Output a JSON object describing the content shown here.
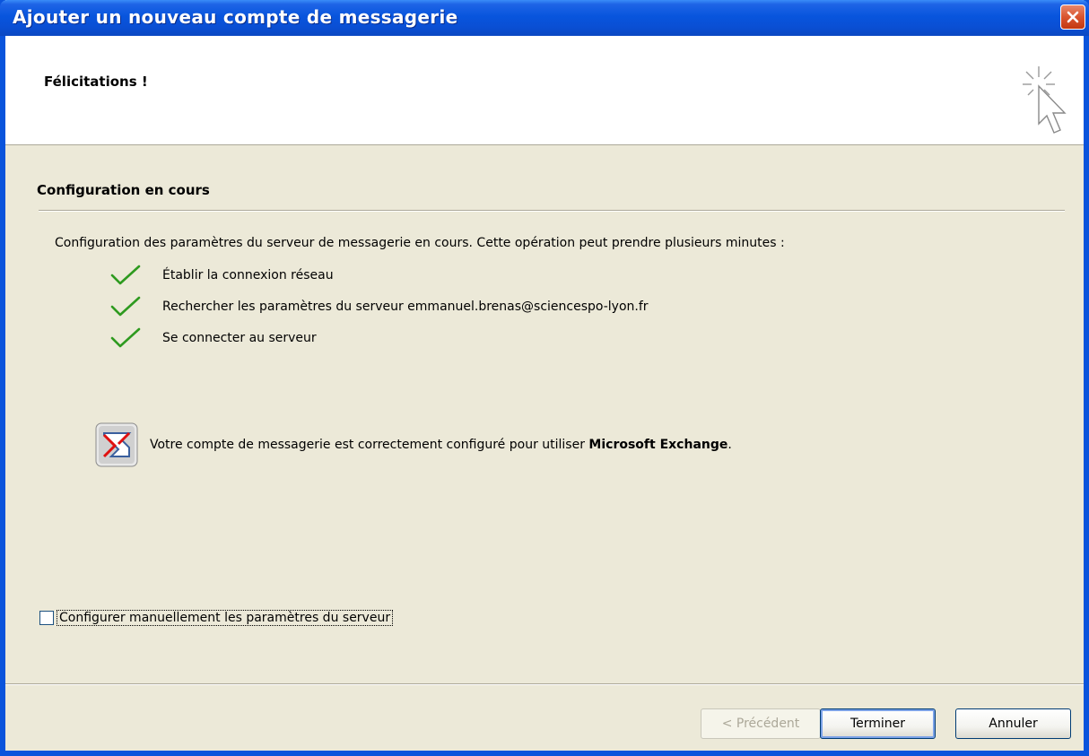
{
  "window": {
    "title": "Ajouter un nouveau compte de messagerie"
  },
  "header": {
    "title": "Félicitations !",
    "icon": "cursor-sparkle-icon"
  },
  "section": {
    "title": "Configuration en cours"
  },
  "description": "Configuration des paramètres du serveur de messagerie en cours. Cette opération peut prendre plusieurs minutes :",
  "steps": [
    {
      "label": "Établir la connexion réseau",
      "status": "done",
      "icon": "checkmark-icon"
    },
    {
      "label": "Rechercher les paramètres du serveur emmanuel.brenas@sciencespo-lyon.fr",
      "status": "done",
      "icon": "checkmark-icon"
    },
    {
      "label": "Se connecter au serveur",
      "status": "done",
      "icon": "checkmark-icon"
    }
  ],
  "result": {
    "icon": "microsoft-exchange-icon",
    "message_prefix": "Votre compte de messagerie est correctement configuré pour utiliser ",
    "message_bold": "Microsoft Exchange",
    "message_suffix": "."
  },
  "manual": {
    "label": "Configurer manuellement les paramètres du serveur",
    "checked": false
  },
  "buttons": {
    "back": "< Précédent",
    "finish": "Terminer",
    "cancel": "Annuler"
  },
  "colors": {
    "titlebar": "#0a54dc",
    "checkmark": "#2e9a1f",
    "background": "#ece9d8",
    "close": "#d9542f"
  }
}
